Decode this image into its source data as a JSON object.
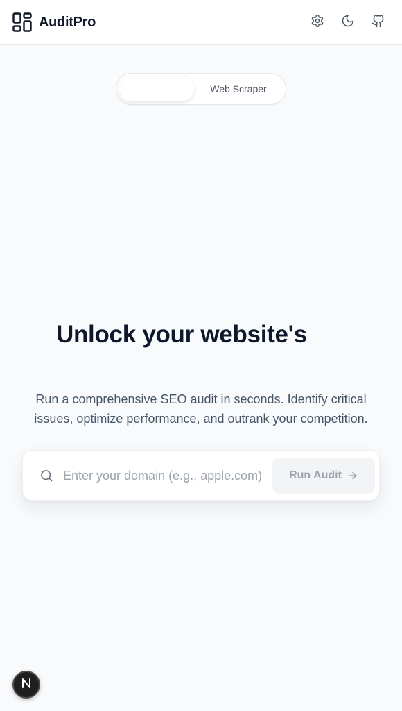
{
  "header": {
    "brand": "AuditPro",
    "icons": [
      "grid-logo-icon",
      "gear-icon",
      "moon-icon",
      "github-icon"
    ]
  },
  "mode_toggle": {
    "active_label": "",
    "other_label": "Web Scraper"
  },
  "hero": {
    "headline": "Unlock your website's",
    "subtext": "Run a comprehensive SEO audit in seconds. Identify critical issues, optimize performance, and outrank your competition."
  },
  "search": {
    "placeholder": "Enter your domain (e.g., apple.com)",
    "value": "",
    "button_label": "Run Audit"
  },
  "dev_badge": {
    "letter": "N"
  },
  "colors": {
    "background": "#f8fafc",
    "text_dark": "#0f172a",
    "muted": "#9ca3af",
    "button_disabled_bg": "#f3f4f6"
  }
}
